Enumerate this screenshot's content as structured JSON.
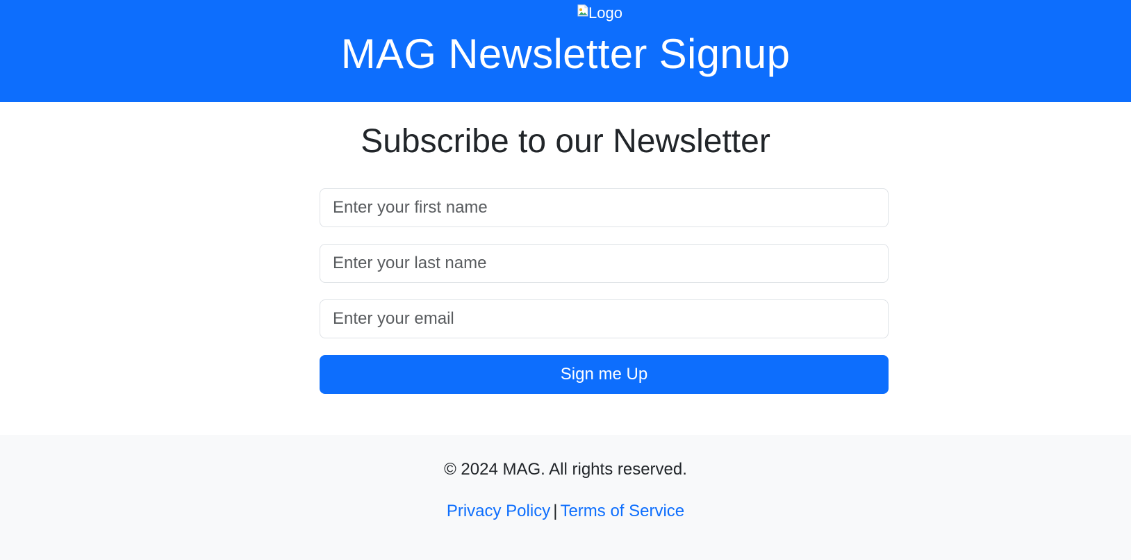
{
  "header": {
    "logo_alt": "Logo",
    "title": "MAG Newsletter Signup"
  },
  "main": {
    "heading": "Subscribe to our Newsletter",
    "first_name": {
      "value": "",
      "placeholder": "Enter your first name"
    },
    "last_name": {
      "value": "",
      "placeholder": "Enter your last name"
    },
    "email": {
      "value": "",
      "placeholder": "Enter your email"
    },
    "submit_label": "Sign me Up"
  },
  "footer": {
    "copyright": "© 2024 MAG. All rights reserved.",
    "privacy_label": "Privacy Policy",
    "separator": "|",
    "terms_label": "Terms of Service"
  },
  "icons": {
    "logo": "broken-image-icon"
  },
  "colors": {
    "primary": "#0d6efd",
    "header_background": "#0d6efd",
    "footer_background": "#f8f9fa",
    "text": "#212529",
    "input_border": "#dee2e6"
  }
}
